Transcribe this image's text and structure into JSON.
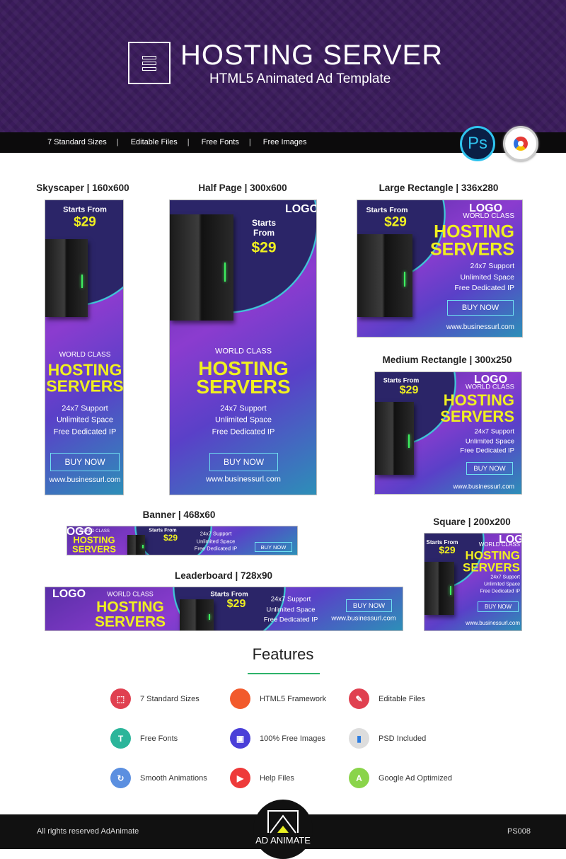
{
  "header": {
    "title": "HOSTING SERVER",
    "subtitle": "HTML5 Animated Ad Template",
    "logo_icon": "server-icon"
  },
  "strip": {
    "items": [
      "7 Standard Sizes",
      "Editable Files",
      "Free Fonts",
      "Free Images"
    ],
    "badges": [
      "Ps",
      "google-web-designer-icon"
    ]
  },
  "ad_content": {
    "starts": "Starts From",
    "starts_word": "Starts",
    "from_word": "From",
    "price": "$29",
    "logo": "LOGO",
    "world_class": "WORLD CLASS",
    "hosting": "HOSTING",
    "servers": "SERVERS",
    "f1": "24x7 Support",
    "f2": "Unlimited Space",
    "f3": "Free Dedicated IP",
    "buy": "BUY NOW",
    "url": "www.businessurl.com"
  },
  "ads": [
    {
      "title": "Skyscaper | 160x600"
    },
    {
      "title": "Half Page | 300x600"
    },
    {
      "title": "Large Rectangle | 336x280"
    },
    {
      "title": "Medium Rectangle | 300x250"
    },
    {
      "title": "Banner | 468x60"
    },
    {
      "title": "Leaderboard | 728x90"
    },
    {
      "title": "Square | 200x200"
    }
  ],
  "colors": {
    "header": "#3b1c5c",
    "accent_yellow": "#f0f020",
    "accent_cyan": "#3fc8d8",
    "features_line": "#2db36a"
  },
  "features": {
    "title": "Features",
    "items": [
      {
        "label": "7 Standard Sizes",
        "icon": "sizes-icon",
        "color": "#e04050"
      },
      {
        "label": "HTML5 Framework",
        "icon": "html5-icon",
        "color": "#f25a2c"
      },
      {
        "label": "Editable Files",
        "icon": "editable-files-icon",
        "color": "#e04050"
      },
      {
        "label": "Free Fonts",
        "icon": "font-icon",
        "color": "#2bb59a"
      },
      {
        "label": "100% Free Images",
        "icon": "images-icon",
        "color": "#4a3fd8"
      },
      {
        "label": "PSD Included",
        "icon": "psd-icon",
        "color": "#dddddd"
      },
      {
        "label": "Smooth Animations",
        "icon": "animation-icon",
        "color": "#5b8fe0"
      },
      {
        "label": "Help Files",
        "icon": "help-files-icon",
        "color": "#ee3a3a"
      },
      {
        "label": "Google Ad Optimized",
        "icon": "google-ads-icon",
        "color": "#8ad44a"
      }
    ]
  },
  "footer": {
    "copyright": "All rights reserved AdAnimate",
    "brand": "AD ANIMATE",
    "code": "PS008"
  }
}
